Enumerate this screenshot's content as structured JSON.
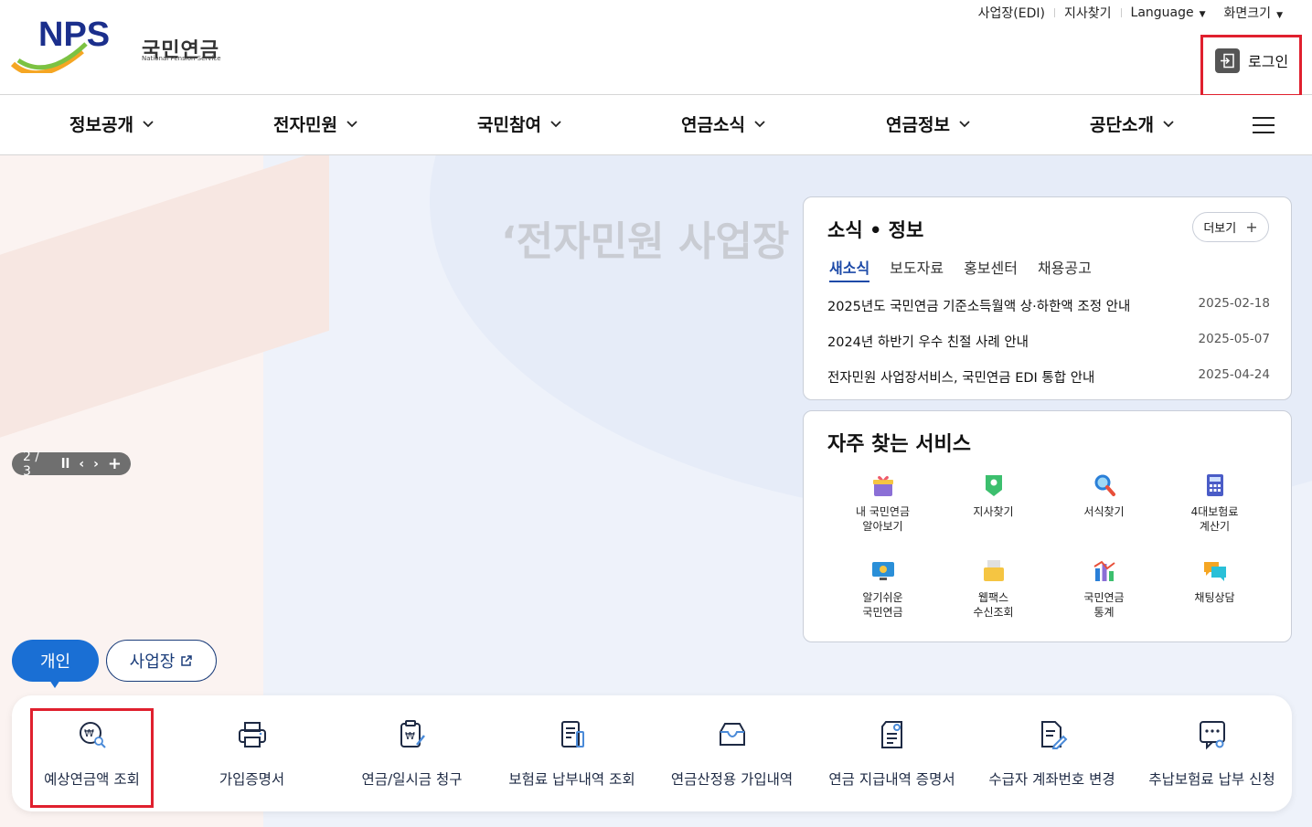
{
  "header": {
    "logo_text": "NPS",
    "logo_ko": "국민연금",
    "logo_en": "National Pension Service",
    "util_links": [
      "사업장(EDI)",
      "지사찾기"
    ],
    "language_label": "Language",
    "screen_size_label": "화면크기",
    "login_label": "로그인"
  },
  "gnb": {
    "items": [
      "정보공개",
      "전자민원",
      "국민참여",
      "연금소식",
      "연금정보",
      "공단소개"
    ]
  },
  "visual": {
    "title": "‘전자민원 사업장",
    "page_indicator": "2 / 3"
  },
  "news": {
    "title": "소식 • 정보",
    "more_label": "더보기",
    "tabs": [
      "새소식",
      "보도자료",
      "홍보센터",
      "채용공고"
    ],
    "active_tab": "새소식",
    "items": [
      {
        "title": "2025년도 국민연금 기준소득월액 상·하한액 조정 안내",
        "date": "2025-02-18"
      },
      {
        "title": "2024년 하반기 우수 친절 사례 안내",
        "date": "2025-05-07"
      },
      {
        "title": "전자민원 사업장서비스, 국민연금 EDI 통합 안내",
        "date": "2025-04-24"
      }
    ]
  },
  "services": {
    "title": "자주 찾는 서비스",
    "items": [
      {
        "label": "내 국민연금\n알아보기",
        "icon": "gift-icon"
      },
      {
        "label": "지사찾기",
        "icon": "location-pin-icon"
      },
      {
        "label": "서식찾기",
        "icon": "magnifier-icon"
      },
      {
        "label": "4대보험료\n계산기",
        "icon": "calculator-icon"
      },
      {
        "label": "알기쉬운\n국민연금",
        "icon": "monitor-icon"
      },
      {
        "label": "웹팩스\n수신조회",
        "icon": "fax-icon"
      },
      {
        "label": "국민연금\n통계",
        "icon": "chart-icon"
      },
      {
        "label": "채팅상담",
        "icon": "chat-icon"
      }
    ]
  },
  "target_tabs": {
    "person": "개인",
    "business": "사업장"
  },
  "quick_menu": {
    "items": [
      {
        "label": "예상연금액 조회",
        "icon": "coin-search-icon"
      },
      {
        "label": "가입증명서",
        "icon": "printer-icon"
      },
      {
        "label": "연금/일시금 청구",
        "icon": "clipboard-won-icon"
      },
      {
        "label": "보험료 납부내역 조회",
        "icon": "document-list-icon"
      },
      {
        "label": "연금산정용 가입내역",
        "icon": "inbox-icon"
      },
      {
        "label": "연금 지급내역 증명서",
        "icon": "certificate-icon"
      },
      {
        "label": "수급자 계좌번호 변경",
        "icon": "document-edit-icon"
      },
      {
        "label": "추납보험료 납부 신청",
        "icon": "chat-doc-icon"
      }
    ]
  },
  "colors": {
    "primary_blue": "#1a6fd4",
    "navy": "#1b3d7a",
    "highlight_red": "#e0202e",
    "logo_green": "#7cc242",
    "logo_orange": "#f5a623"
  }
}
